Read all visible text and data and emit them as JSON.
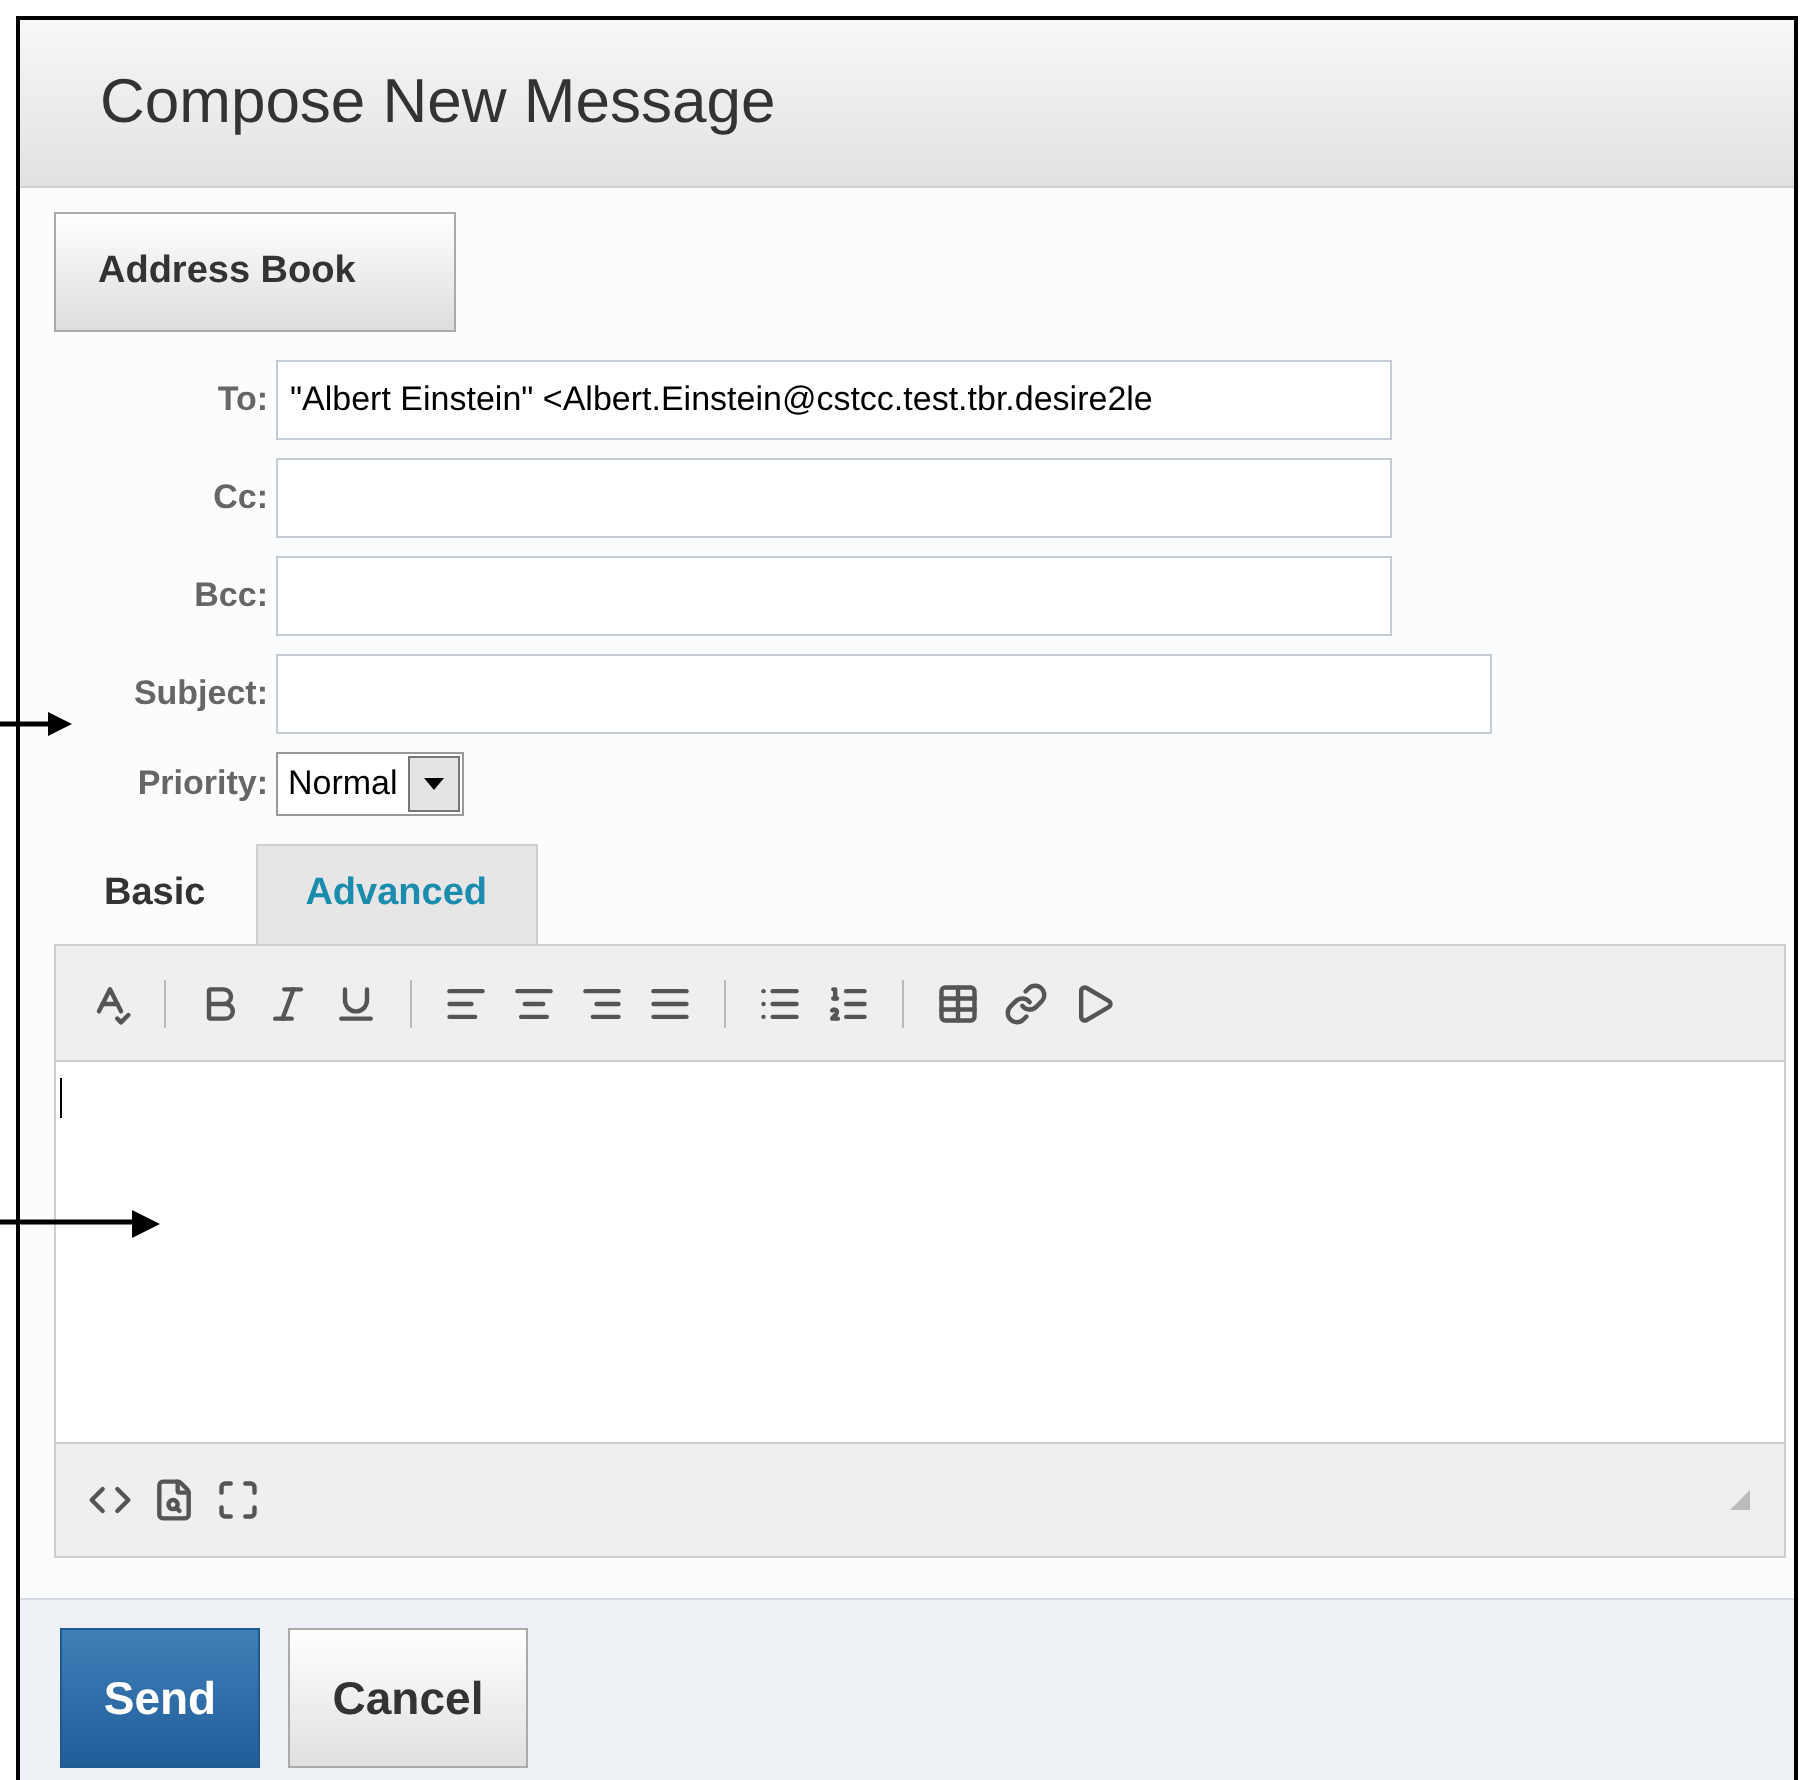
{
  "window": {
    "title": "Compose New Message"
  },
  "address_book_button": "Address Book",
  "fields": [
    {
      "label": "To:",
      "value": "\"Albert Einstein\" <Albert.Einstein@cstcc.test.tbr.desire2le"
    },
    {
      "label": "Cc:"
    },
    {
      "label": "Bcc:"
    }
  ],
  "subject": {
    "label": "Subject:"
  },
  "priority": {
    "label": "Priority:",
    "value": "Normal"
  },
  "tabs": [
    {
      "label": "Basic",
      "selected": true
    },
    {
      "label": "Advanced",
      "selected": false
    }
  ],
  "buttons": [
    {
      "label": "Send",
      "kind": "primary"
    },
    {
      "label": "Cancel",
      "kind": "secondary"
    }
  ]
}
